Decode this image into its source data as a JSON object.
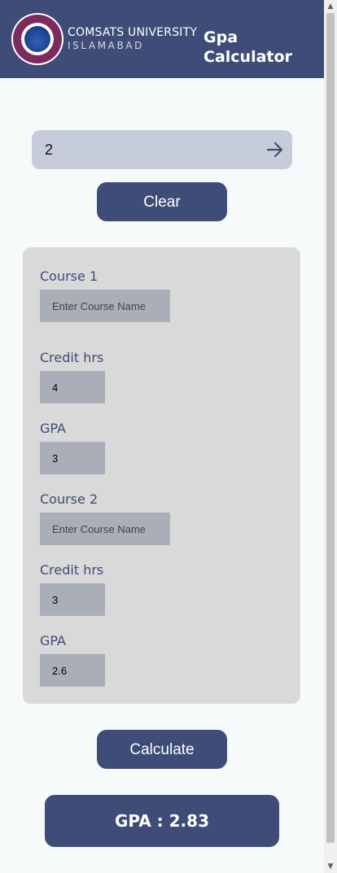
{
  "header": {
    "university_name": "COMSATS UNIVERSITY",
    "university_city": "ISLAMABAD",
    "app_title": "Gpa Calculator",
    "logo_icon": "comsats-university-seal"
  },
  "course_count": {
    "value": "2",
    "submit_icon": "arrow-right-icon"
  },
  "clear_label": "Clear",
  "courses": [
    {
      "title": "Course 1",
      "name_placeholder": "Enter Course Name",
      "name_value": "",
      "credit_label": "Credit hrs",
      "credit_value": "4",
      "gpa_label": "GPA",
      "gpa_value": "3"
    },
    {
      "title": "Course 2",
      "name_placeholder": "Enter Course Name",
      "name_value": "",
      "credit_label": "Credit hrs",
      "credit_value": "3",
      "gpa_label": "GPA",
      "gpa_value": "2.6"
    }
  ],
  "calculate_label": "Calculate",
  "result": "GPA : 2.83",
  "colors": {
    "primary": "#3f4c77",
    "page_background": "#f7fafa",
    "card_background": "#d9d9d9",
    "input_background": "#a9aeb8",
    "count_bar_background": "#c6ccda"
  }
}
